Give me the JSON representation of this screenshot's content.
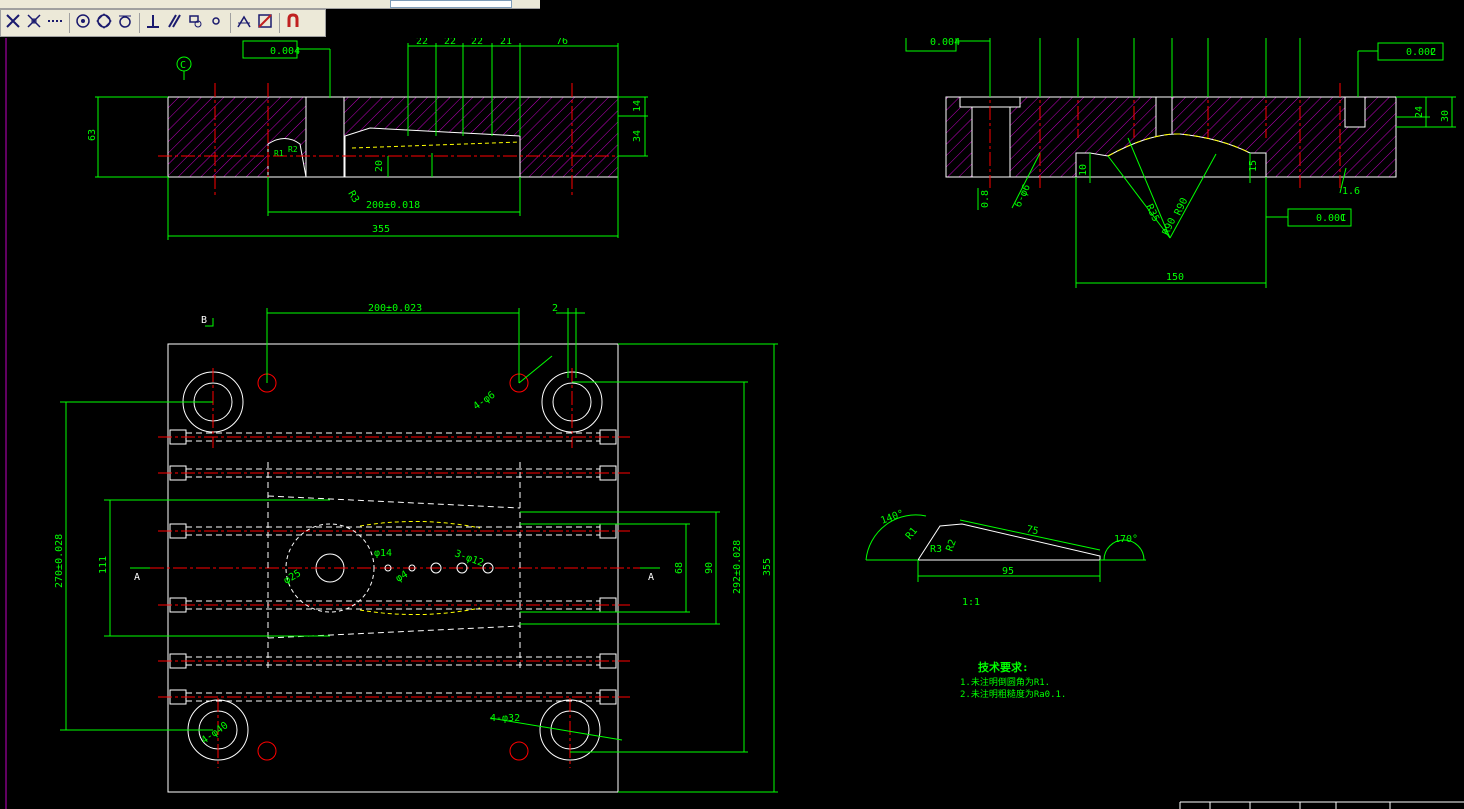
{
  "toolbar": {
    "buttons": [
      {
        "name": "snap-intersection-icon",
        "color": "#1a1a6e"
      },
      {
        "name": "snap-apparent-intersection-icon",
        "color": "#1a1a6e"
      },
      {
        "name": "snap-extension-icon",
        "color": "#1a1a6e"
      },
      {
        "sep": true
      },
      {
        "name": "snap-center-icon",
        "color": "#1a1a6e"
      },
      {
        "name": "snap-quadrant-icon",
        "color": "#1a1a6e"
      },
      {
        "name": "snap-tangent-icon",
        "color": "#1a1a6e"
      },
      {
        "sep": true
      },
      {
        "name": "snap-perpendicular-icon",
        "color": "#1a1a6e"
      },
      {
        "name": "snap-parallel-icon",
        "color": "#1a1a6e"
      },
      {
        "name": "snap-insert-icon",
        "color": "#1a1a6e"
      },
      {
        "name": "snap-node-icon",
        "color": "#1a1a6e"
      },
      {
        "sep": true
      },
      {
        "name": "snap-nearest-icon",
        "color": "#1a1a6e"
      },
      {
        "name": "snap-none-icon",
        "color": "#c02020"
      },
      {
        "sep": true
      },
      {
        "name": "osnap-settings-icon",
        "color": "#c02020"
      }
    ]
  },
  "drawing": {
    "colors": {
      "outline": "#ffffff",
      "dimension": "#00ff00",
      "centerline": "#ff0000",
      "hatch": "#c000c0",
      "hidden": "#ffff00",
      "text": "#00ff00"
    },
    "section_view": {
      "tolerance_frame": "0.004",
      "datum": "C",
      "dims": {
        "d22a": "22",
        "d22b": "22",
        "d22c": "22",
        "d21": "21",
        "d76": "76",
        "d14": "14",
        "d34": "34",
        "d63": "63",
        "d20": "20",
        "dR3": "R3",
        "d200": "200±0.018",
        "d355": "355",
        "r1": "R1",
        "r2": "R2"
      }
    },
    "right_view": {
      "tolerance_frame_top": "0.004",
      "tol_0002": "0.002",
      "tol_0001": "0.001",
      "datum": "C",
      "dims": {
        "d24": "24",
        "d30": "30",
        "d10": "10",
        "d15": "15",
        "d150": "150",
        "hole_note": "6-φ6",
        "r35": "R35",
        "r90a": "R90",
        "r90b": "R90",
        "d0_8": "0.8",
        "d1_6": "1.6"
      }
    },
    "plan_view": {
      "section_label": "B",
      "dims": {
        "d200_023": "200±0.023",
        "d2": "2",
        "d4phi6": "4-φ6",
        "d270": "270±0.028",
        "d111": "111",
        "d68": "68",
        "d90": "90",
        "d292": "292±0.028",
        "d355": "355",
        "phi25": "φ25",
        "phi14": "φ14",
        "phi4": "φ4",
        "phi12": "3-φ12",
        "phi32": "4-φ32",
        "phi40": "4-φ40"
      },
      "section_a_left": "A",
      "section_a_right": "A"
    },
    "detail": {
      "dims": {
        "a140": "140°",
        "a170": "170°",
        "d75": "75",
        "d95": "95",
        "r3": "R3",
        "r2": "R2",
        "r1": "R1"
      },
      "scale": "1:1"
    },
    "notes": {
      "title": "技术要求:",
      "line1": "1.未注明倒圆角为R1.",
      "line2": "2.未注明粗糙度为Ra0.1."
    }
  }
}
